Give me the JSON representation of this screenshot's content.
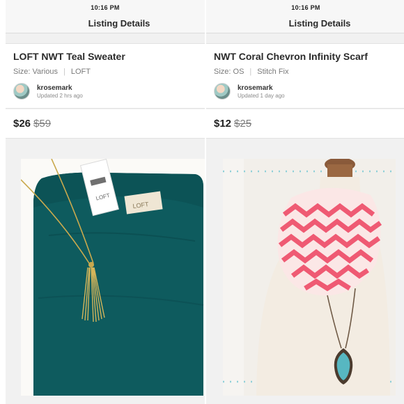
{
  "listings": [
    {
      "status_time": "10:16 PM",
      "nav_title": "Listing Details",
      "title": "LOFT NWT Teal Sweater",
      "size": "Size: Various",
      "brand": "LOFT",
      "seller": "krosemark",
      "updated": "Updated 2 hrs ago",
      "price": "$26",
      "original_price": "$59",
      "photo": "teal-sweater-with-gold-tassel-necklace",
      "hang_tag_brand": "LOFT"
    },
    {
      "status_time": "10:16 PM",
      "nav_title": "Listing Details",
      "title": "NWT Coral Chevron Infinity Scarf",
      "size": "Size: OS",
      "brand": "Stitch Fix",
      "seller": "krosemark",
      "updated": "Updated 1 day ago",
      "price": "$12",
      "original_price": "$25",
      "photo": "coral-chevron-scarf-on-mannequin"
    }
  ],
  "colors": {
    "teal": "#0e5b5e",
    "coral": "#ef5a73",
    "gold": "#c9a94e",
    "turquoise": "#57b7c1"
  }
}
